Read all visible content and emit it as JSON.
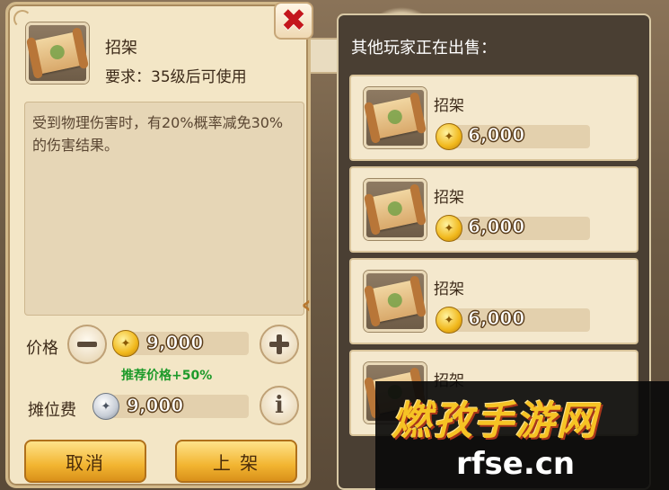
{
  "item": {
    "name": "招架",
    "requirement": "要求：35级后可使用",
    "description": "受到物理伤害时，有20%概率减免30%的伤害结果。"
  },
  "pricing": {
    "price_label": "价格",
    "price_value": "9,000",
    "recommend": "推荐价格+50%",
    "fee_label": "摊位费",
    "fee_value": "9,000"
  },
  "actions": {
    "cancel_label": "取消",
    "list_label": "上 架"
  },
  "market": {
    "title": "其他玩家正在出售：",
    "listings": [
      {
        "name": "招架",
        "price": "6,000"
      },
      {
        "name": "招架",
        "price": "6,000"
      },
      {
        "name": "招架",
        "price": "6,000"
      },
      {
        "name": "招架",
        "price": ""
      }
    ]
  },
  "watermark": {
    "logo": "燃孜手游网",
    "url": "rfse.cn"
  },
  "colors": {
    "panel_bg": "#f3e6c6",
    "accent_gold": "#f2b531",
    "close_red": "#c4161c",
    "recommend_green": "#1d9a2a"
  },
  "icons": [
    "close-icon",
    "scroll-item-icon",
    "gold-coin-icon",
    "silver-coin-icon",
    "minus-icon",
    "plus-icon",
    "info-icon",
    "collapse-arrow-icon"
  ]
}
